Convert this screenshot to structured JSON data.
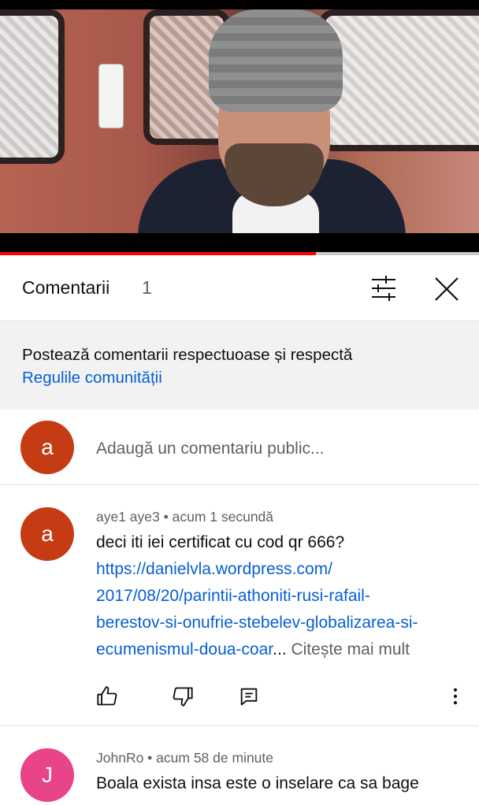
{
  "video": {
    "progress": 0.66
  },
  "comments_panel": {
    "title": "Comentarii",
    "count": "1",
    "filter_icon": "filter-sliders-icon",
    "close_icon": "close-icon"
  },
  "guidelines": {
    "text": "Postează comentarii respectuoase și respectă",
    "link": "Regulile comunității"
  },
  "add_comment": {
    "avatar_letter": "a",
    "placeholder": "Adaugă un comentariu public..."
  },
  "comments": [
    {
      "author": "aye1 aye3",
      "time": "acum 1 secundă",
      "meta": "aye1 aye3 • acum 1 secundă",
      "avatar_letter": "a",
      "text": "deci iti iei certificat cu cod qr 666?",
      "link_lines": [
        "https://danielvla.wordpress.com/",
        "2017/08/20/parintii-athoniti-rusi-rafail-",
        "berestov-si-onufrie-stebelev-globalizarea-si-",
        "ecumenismul-doua-coar"
      ],
      "ellipsis": "...",
      "read_more": "Citește mai mult"
    },
    {
      "author": "JohnRo",
      "time": "acum 58 de minute",
      "meta": "JohnRo • acum 58 de minute",
      "avatar_letter": "J",
      "text": "Boala exista insa este o inselare ca sa bage"
    }
  ],
  "colors": {
    "accent_red": "#ff0000",
    "link_blue": "#065fd4",
    "avatar_a": "#c43b14",
    "avatar_j": "#e94389"
  }
}
